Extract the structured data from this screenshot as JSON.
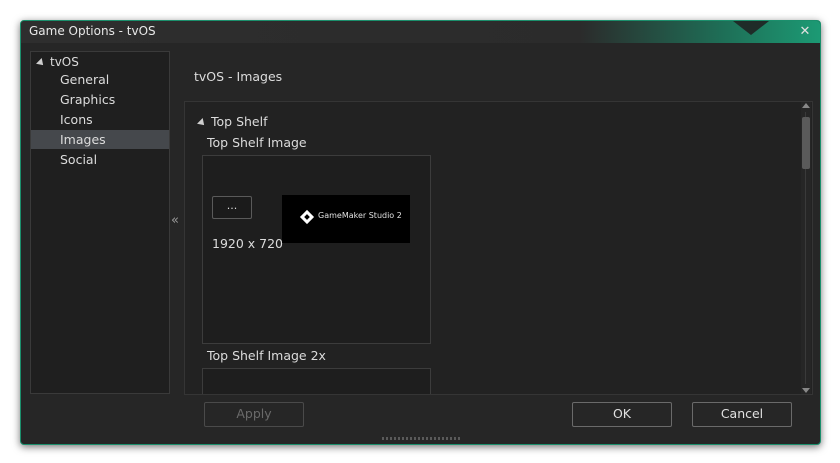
{
  "window": {
    "title": "Game Options - tvOS",
    "close_glyph": "✕",
    "accent_color": "#1c9a74"
  },
  "sidebar": {
    "root_label": "tvOS",
    "items": [
      {
        "label": "General",
        "selected": false
      },
      {
        "label": "Graphics",
        "selected": false
      },
      {
        "label": "Icons",
        "selected": false
      },
      {
        "label": "Images",
        "selected": true
      },
      {
        "label": "Social",
        "selected": false
      }
    ],
    "collapse_glyph": "«"
  },
  "main": {
    "panel_title": "tvOS - Images",
    "section_title": "Top Shelf",
    "fields": [
      {
        "label": "Top Shelf Image",
        "browse_label": "...",
        "dimensions": "1920 x 720",
        "preview_text": "GameMaker Studio 2"
      },
      {
        "label": "Top Shelf Image 2x"
      }
    ]
  },
  "footer": {
    "apply_label": "Apply",
    "ok_label": "OK",
    "cancel_label": "Cancel"
  }
}
